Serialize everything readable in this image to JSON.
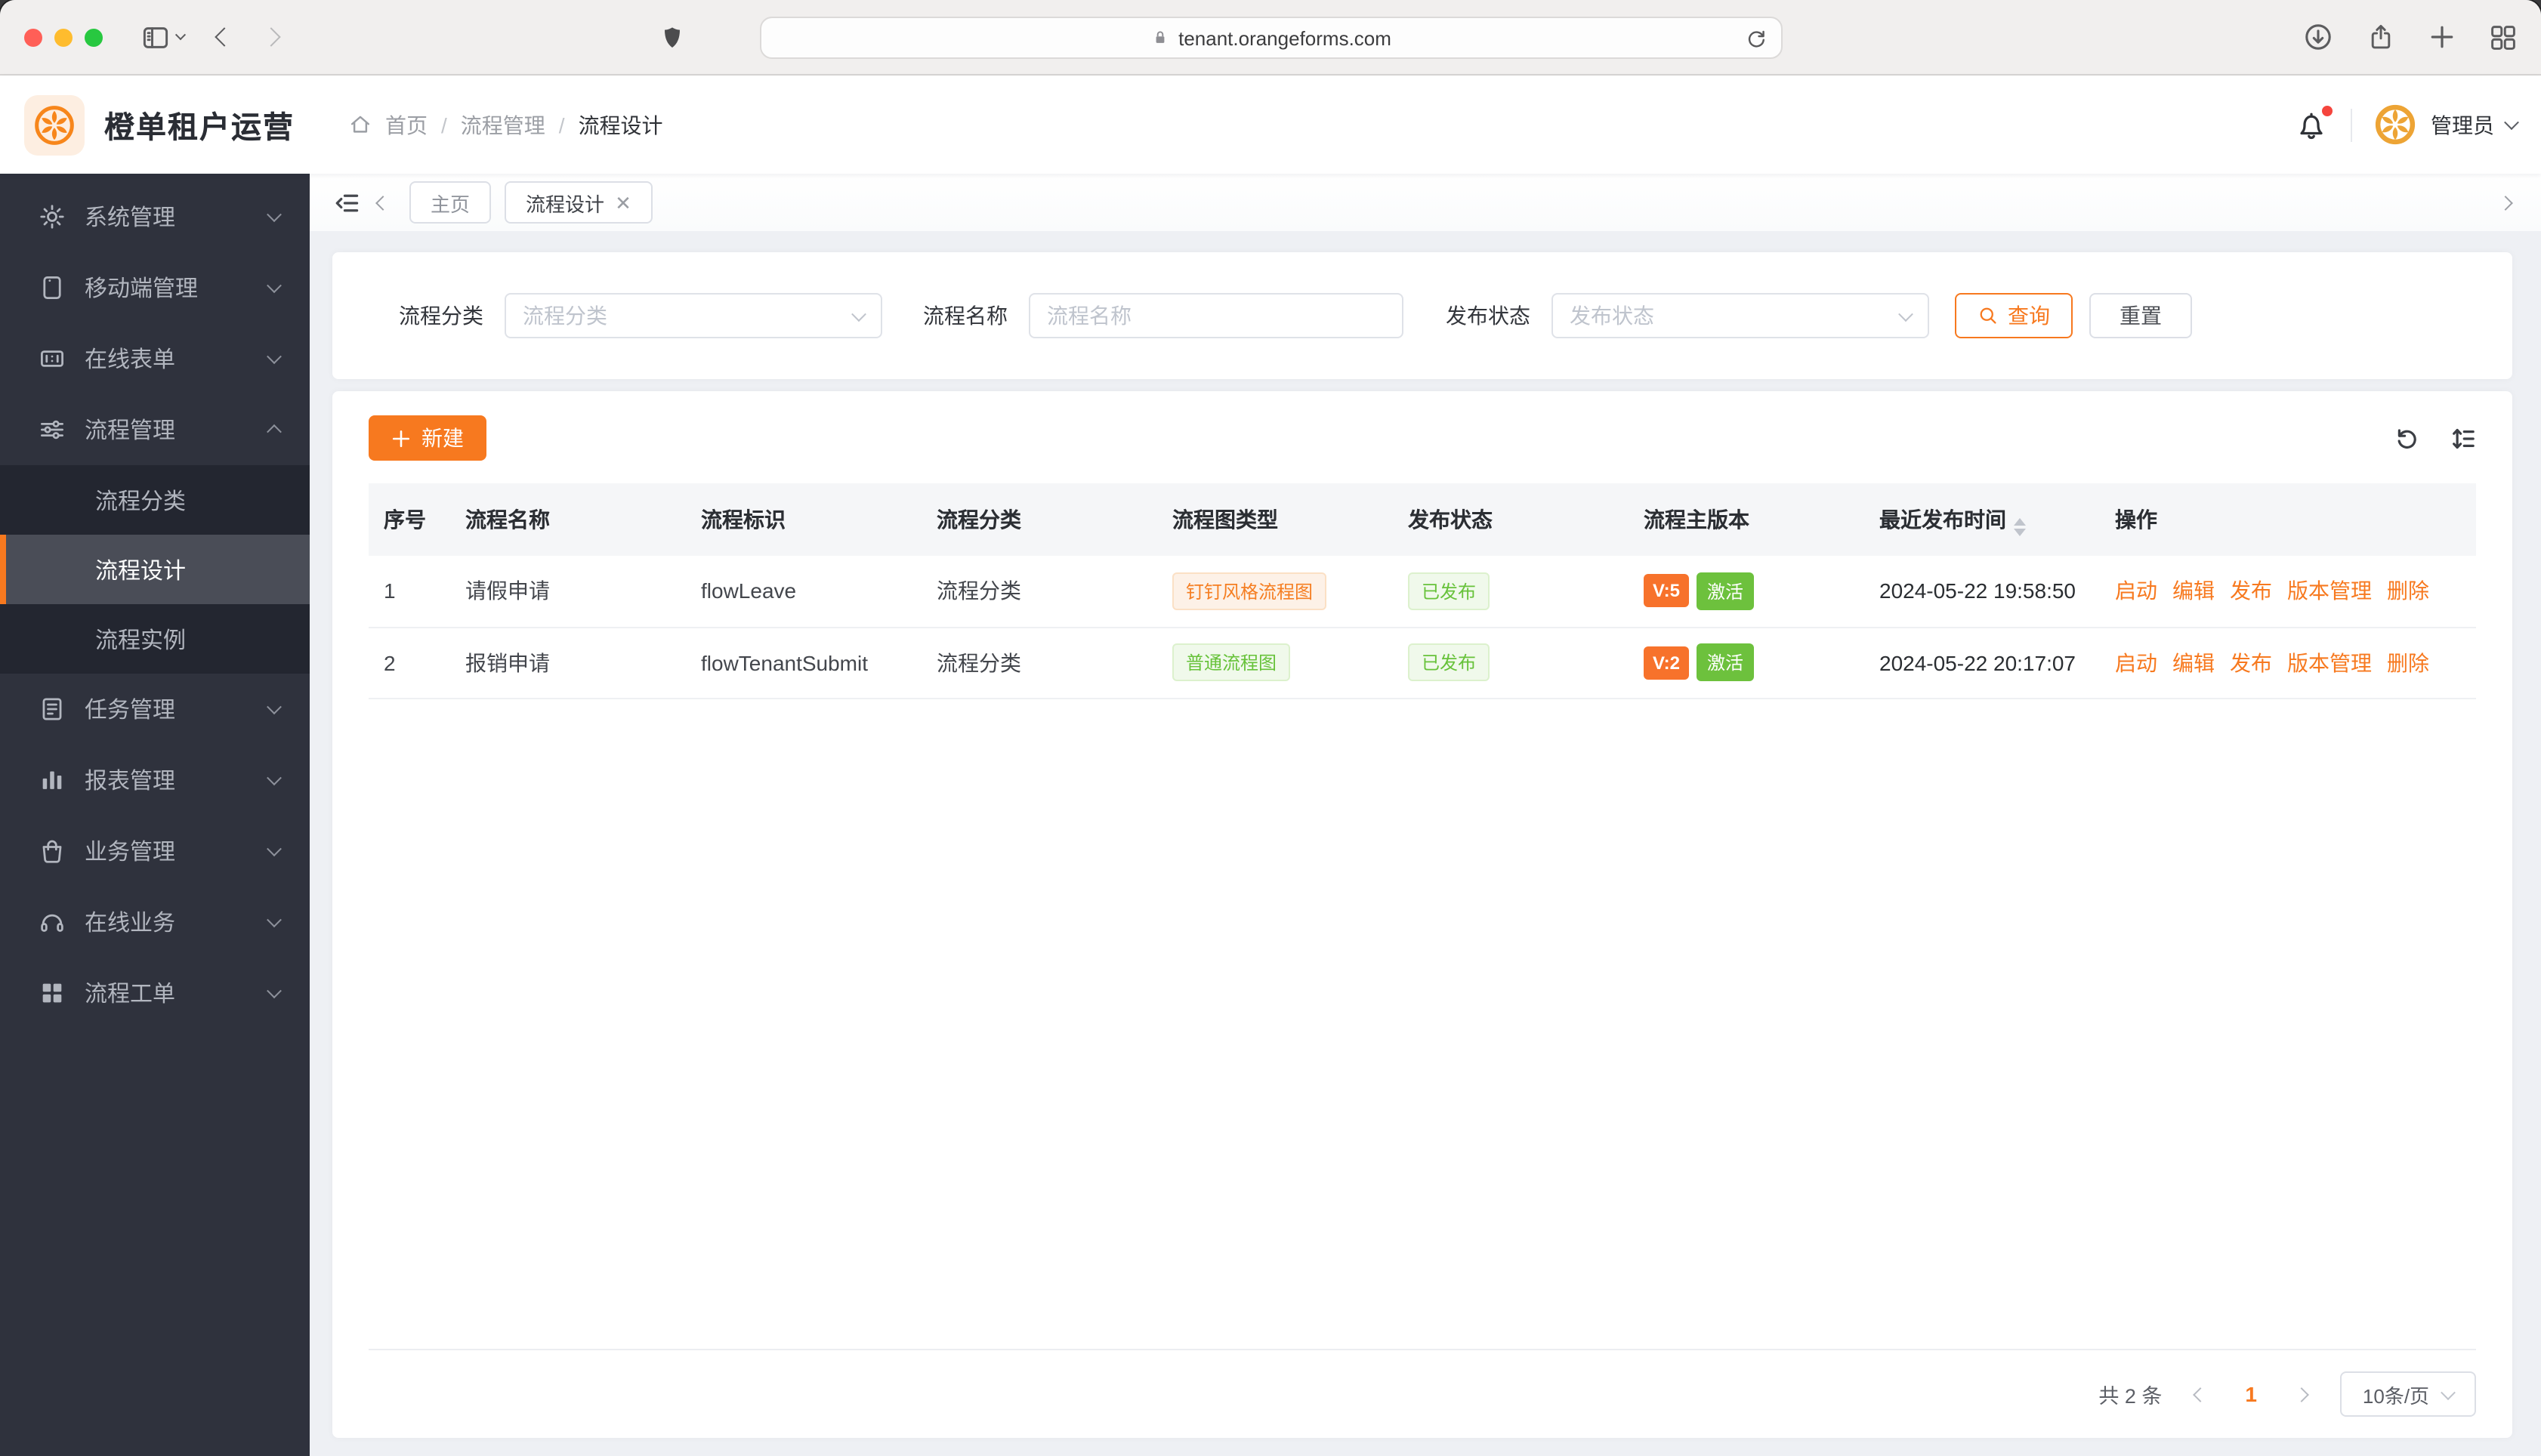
{
  "browser": {
    "url": "tenant.orangeforms.com"
  },
  "header": {
    "app_title": "橙单租户运营",
    "breadcrumb": [
      "首页",
      "流程管理",
      "流程设计"
    ],
    "user_name": "管理员"
  },
  "sidebar": {
    "items": [
      {
        "label": "系统管理",
        "icon": "gear-icon"
      },
      {
        "label": "移动端管理",
        "icon": "mobile-icon"
      },
      {
        "label": "在线表单",
        "icon": "form-icon"
      },
      {
        "label": "流程管理",
        "icon": "sliders-icon",
        "expanded": true,
        "children": [
          {
            "label": "流程分类"
          },
          {
            "label": "流程设计",
            "active": true
          },
          {
            "label": "流程实例"
          }
        ]
      },
      {
        "label": "任务管理",
        "icon": "document-icon"
      },
      {
        "label": "报表管理",
        "icon": "bar-chart-icon"
      },
      {
        "label": "业务管理",
        "icon": "bag-icon"
      },
      {
        "label": "在线业务",
        "icon": "headset-icon"
      },
      {
        "label": "流程工单",
        "icon": "grid-icon"
      }
    ]
  },
  "tabs": {
    "items": [
      {
        "label": "主页"
      },
      {
        "label": "流程设计",
        "active": true,
        "closable": true
      }
    ]
  },
  "filters": {
    "category_label": "流程分类",
    "category_placeholder": "流程分类",
    "name_label": "流程名称",
    "name_placeholder": "流程名称",
    "status_label": "发布状态",
    "status_placeholder": "发布状态",
    "query_label": "查询",
    "reset_label": "重置"
  },
  "toolbar": {
    "create_label": "新建"
  },
  "table": {
    "columns": [
      "序号",
      "流程名称",
      "流程标识",
      "流程分类",
      "流程图类型",
      "发布状态",
      "流程主版本",
      "最近发布时间",
      "操作"
    ],
    "actions": [
      "启动",
      "编辑",
      "发布",
      "版本管理",
      "删除"
    ],
    "rows": [
      {
        "index": "1",
        "name": "请假申请",
        "key": "flowLeave",
        "category": "流程分类",
        "diagram_type": "钉钉风格流程图",
        "diagram_style": "orange",
        "publish_status": "已发布",
        "version": "V:5",
        "active_label": "激活",
        "publish_time": "2024-05-22 19:58:50"
      },
      {
        "index": "2",
        "name": "报销申请",
        "key": "flowTenantSubmit",
        "category": "流程分类",
        "diagram_type": "普通流程图",
        "diagram_style": "green",
        "publish_status": "已发布",
        "version": "V:2",
        "active_label": "激活",
        "publish_time": "2024-05-22 20:17:07"
      }
    ]
  },
  "pagination": {
    "total": "共 2 条",
    "page": "1",
    "page_size": "10条/页"
  },
  "colors": {
    "primary": "#f7791f",
    "success": "#67c23a",
    "version_tag": "#f7722b",
    "active_tag": "#6dc13d"
  }
}
